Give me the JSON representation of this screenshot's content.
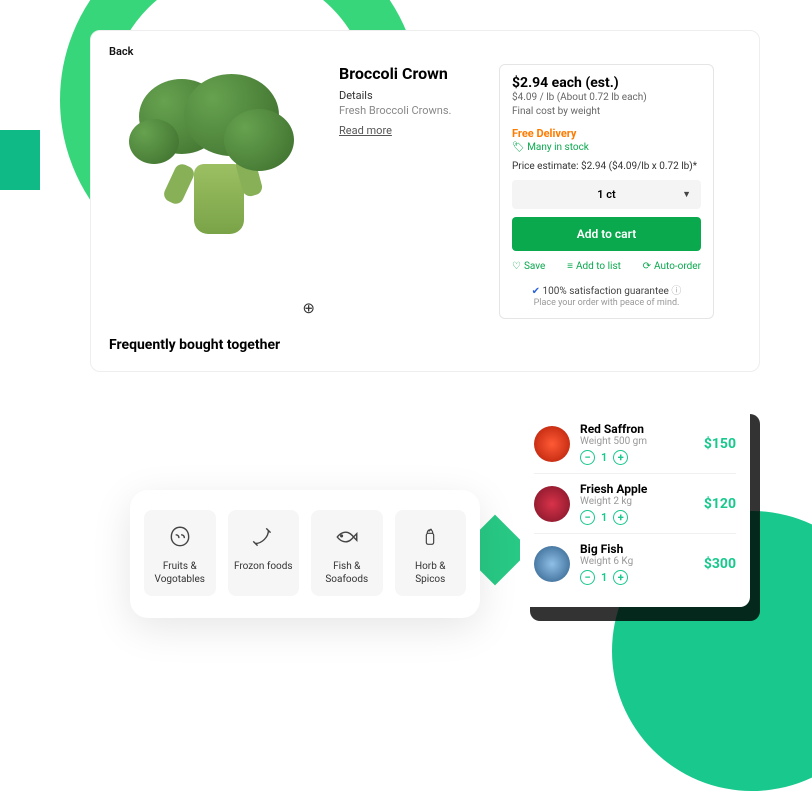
{
  "product": {
    "back_label": "Back",
    "title": "Broccoli Crown",
    "details_heading": "Details",
    "details_text": "Fresh Broccoli Crowns.",
    "read_more": "Read more",
    "freq_heading": "Frequently bought together"
  },
  "buy": {
    "price": "$2.94 each (est.)",
    "unit": "$4.09 / lb (About 0.72 lb each)",
    "final": "Final cost by weight",
    "free_delivery": "Free Delivery",
    "stock": "Many in stock",
    "estimate": "Price estimate: $2.94 ($4.09/lb x 0.72 lb)*",
    "qty_label": "1 ct",
    "add_label": "Add to cart",
    "save_label": "Save",
    "addlist_label": "Add to list",
    "autoorder_label": "Auto-order",
    "guarantee": "100% satisfaction guarantee",
    "guarantee_sub": "Place your order with peace of mind."
  },
  "categories": [
    {
      "label": "Fruits & Vogotables"
    },
    {
      "label": "Frozon foods"
    },
    {
      "label": "Fish & Soafoods"
    },
    {
      "label": "Horb & Spicos"
    }
  ],
  "cart": [
    {
      "name": "Red Saffron",
      "weight": "Weight 500 gm",
      "qty": "1",
      "price": "$150"
    },
    {
      "name": "Friesh Apple",
      "weight": "Weight 2 kg",
      "qty": "1",
      "price": "$120"
    },
    {
      "name": "Big Fish",
      "weight": "Weight 6 Kg",
      "qty": "1",
      "price": "$300"
    }
  ]
}
